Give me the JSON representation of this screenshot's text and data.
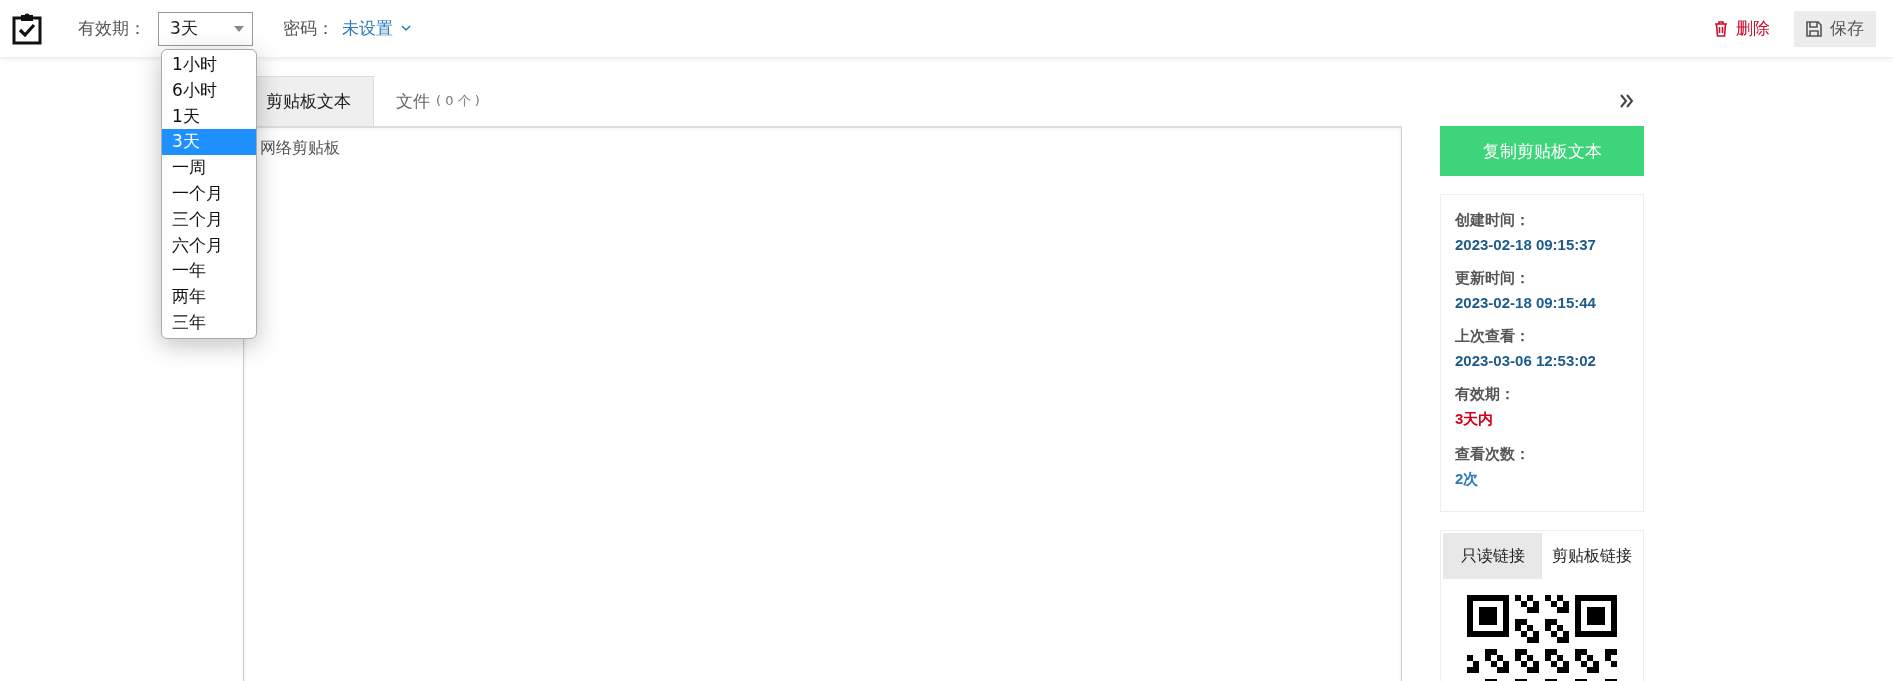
{
  "header": {
    "expiry_label": "有效期：",
    "expiry_select": {
      "value": "3天",
      "expanded": true,
      "options": [
        {
          "label": "1小时",
          "selected": false
        },
        {
          "label": "6小时",
          "selected": false
        },
        {
          "label": "1天",
          "selected": false
        },
        {
          "label": "3天",
          "selected": true
        },
        {
          "label": "一周",
          "selected": false
        },
        {
          "label": "一个月",
          "selected": false
        },
        {
          "label": "三个月",
          "selected": false
        },
        {
          "label": "六个月",
          "selected": false
        },
        {
          "label": "一年",
          "selected": false
        },
        {
          "label": "两年",
          "selected": false
        },
        {
          "label": "三年",
          "selected": false
        }
      ]
    },
    "password_label": "密码：",
    "password_value": "未设置",
    "buttons": [
      {
        "kind": "delete",
        "label": "删除"
      },
      {
        "kind": "save",
        "label": "保存"
      }
    ]
  },
  "tabs": [
    {
      "label": "剪贴板文本",
      "selected": true
    },
    {
      "label": "文件",
      "count": "( 0 个 )",
      "selected": false
    }
  ],
  "editor": {
    "value": "网络剪贴板"
  },
  "sidebar": {
    "copy_button": "复制剪贴板文本",
    "info": [
      {
        "label": "创建时间：",
        "value": "2023-02-18 09:15:37",
        "color": "#1d5b8c"
      },
      {
        "label": "更新时间：",
        "value": "2023-02-18 09:15:44",
        "color": "#1d5b8c"
      },
      {
        "label": "上次查看：",
        "value": "2023-03-06 12:53:02",
        "color": "#1d5b8c"
      },
      {
        "label": "有效期：",
        "value": "3天内",
        "color": "#d0021b"
      },
      {
        "label": "查看次数：",
        "value": "2次",
        "color": "#2a7ab8"
      }
    ],
    "link_tabs": [
      {
        "label": "只读链接",
        "selected": true
      },
      {
        "label": "剪贴板链接",
        "selected": false
      }
    ]
  }
}
